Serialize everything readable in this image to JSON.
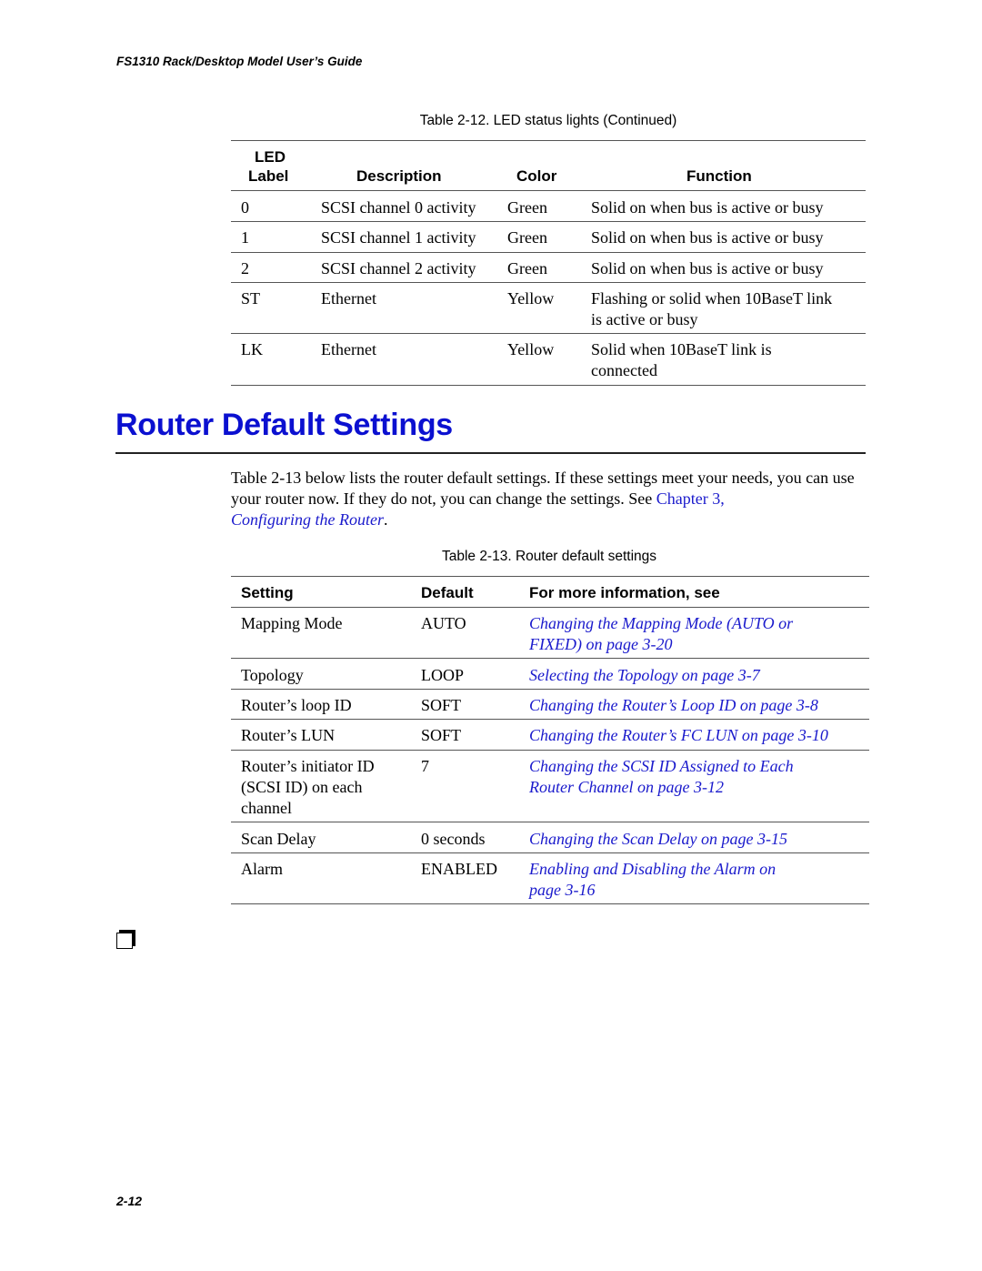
{
  "running_header": "FS1310 Rack/Desktop Model User’s Guide",
  "table_12": {
    "caption": "Table 2-12. LED status lights (Continued)",
    "headers": {
      "led_label_line1": "LED",
      "led_label_line2": "Label",
      "description": "Description",
      "color": "Color",
      "function": "Function"
    },
    "rows": [
      {
        "label": "0",
        "description": "SCSI channel 0 activity",
        "color": "Green",
        "function_line1": "Solid on when bus is active or busy",
        "function_line2": ""
      },
      {
        "label": "1",
        "description": "SCSI channel 1 activity",
        "color": "Green",
        "function_line1": "Solid on when bus is active or busy",
        "function_line2": ""
      },
      {
        "label": "2",
        "description": "SCSI channel 2 activity",
        "color": "Green",
        "function_line1": "Solid on when bus is active or busy",
        "function_line2": ""
      },
      {
        "label": "ST",
        "description": "Ethernet",
        "color": "Yellow",
        "function_line1": "Flashing or solid when 10BaseT link",
        "function_line2": "is active or busy"
      },
      {
        "label": "LK",
        "description": "Ethernet",
        "color": "Yellow",
        "function_line1": "Solid when 10BaseT link is",
        "function_line2": "connected"
      }
    ]
  },
  "section": {
    "heading": "Router Default Settings",
    "para_part1": "Table 2-13 below lists the router default settings. If these settings meet your needs, you can use your router now. If they do not, you can change the settings. See ",
    "para_link1": "Chapter 3,",
    "para_link2": "Configuring the Router",
    "para_end": "."
  },
  "table_13": {
    "caption": "Table 2-13. Router default settings",
    "headers": {
      "setting": "Setting",
      "default": "Default",
      "info": "For more information, see"
    },
    "rows": [
      {
        "setting_line1": "Mapping Mode",
        "setting_line2": "",
        "setting_line3": "",
        "default": "AUTO",
        "link_line1": "Changing the Mapping Mode (AUTO or",
        "link_line2": "FIXED) on page 3-20"
      },
      {
        "setting_line1": "Topology",
        "setting_line2": "",
        "setting_line3": "",
        "default": "LOOP",
        "link_line1": "Selecting the Topology on page 3-7",
        "link_line2": ""
      },
      {
        "setting_line1": "Router’s loop ID",
        "setting_line2": "",
        "setting_line3": "",
        "default": "SOFT",
        "link_line1": "Changing the Router’s Loop ID on page 3-8",
        "link_line2": ""
      },
      {
        "setting_line1": "Router’s LUN",
        "setting_line2": "",
        "setting_line3": "",
        "default": "SOFT",
        "link_line1": "Changing the Router’s FC LUN on page 3-10",
        "link_line2": ""
      },
      {
        "setting_line1": "Router’s initiator ID",
        "setting_line2": "(SCSI ID) on each",
        "setting_line3": "channel",
        "default": "7",
        "link_line1": "Changing the SCSI ID Assigned to Each",
        "link_line2": "Router Channel on page 3-12"
      },
      {
        "setting_line1": "Scan Delay",
        "setting_line2": "",
        "setting_line3": "",
        "default": "0 seconds",
        "link_line1": "Changing the Scan Delay on page 3-15",
        "link_line2": ""
      },
      {
        "setting_line1": "Alarm",
        "setting_line2": "",
        "setting_line3": "",
        "default": "ENABLED",
        "link_line1": "Enabling and Disabling the Alarm on",
        "link_line2": "page 3-16"
      }
    ]
  },
  "end_mark_icon": "end-of-section-box",
  "page_number": "2-12"
}
